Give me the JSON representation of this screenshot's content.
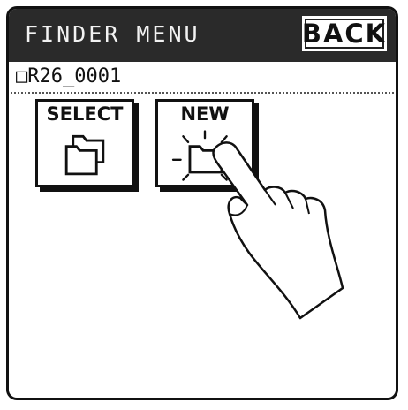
{
  "header": {
    "title": "FINDER MENU",
    "back_label": "BACK"
  },
  "path": {
    "text": "□R26_0001"
  },
  "buttons": [
    {
      "label": "SELECT",
      "icon": "folder-stack-icon"
    },
    {
      "label": "NEW",
      "icon": "new-folder-icon"
    }
  ],
  "pointer": {
    "icon": "hand-pointer-icon"
  }
}
